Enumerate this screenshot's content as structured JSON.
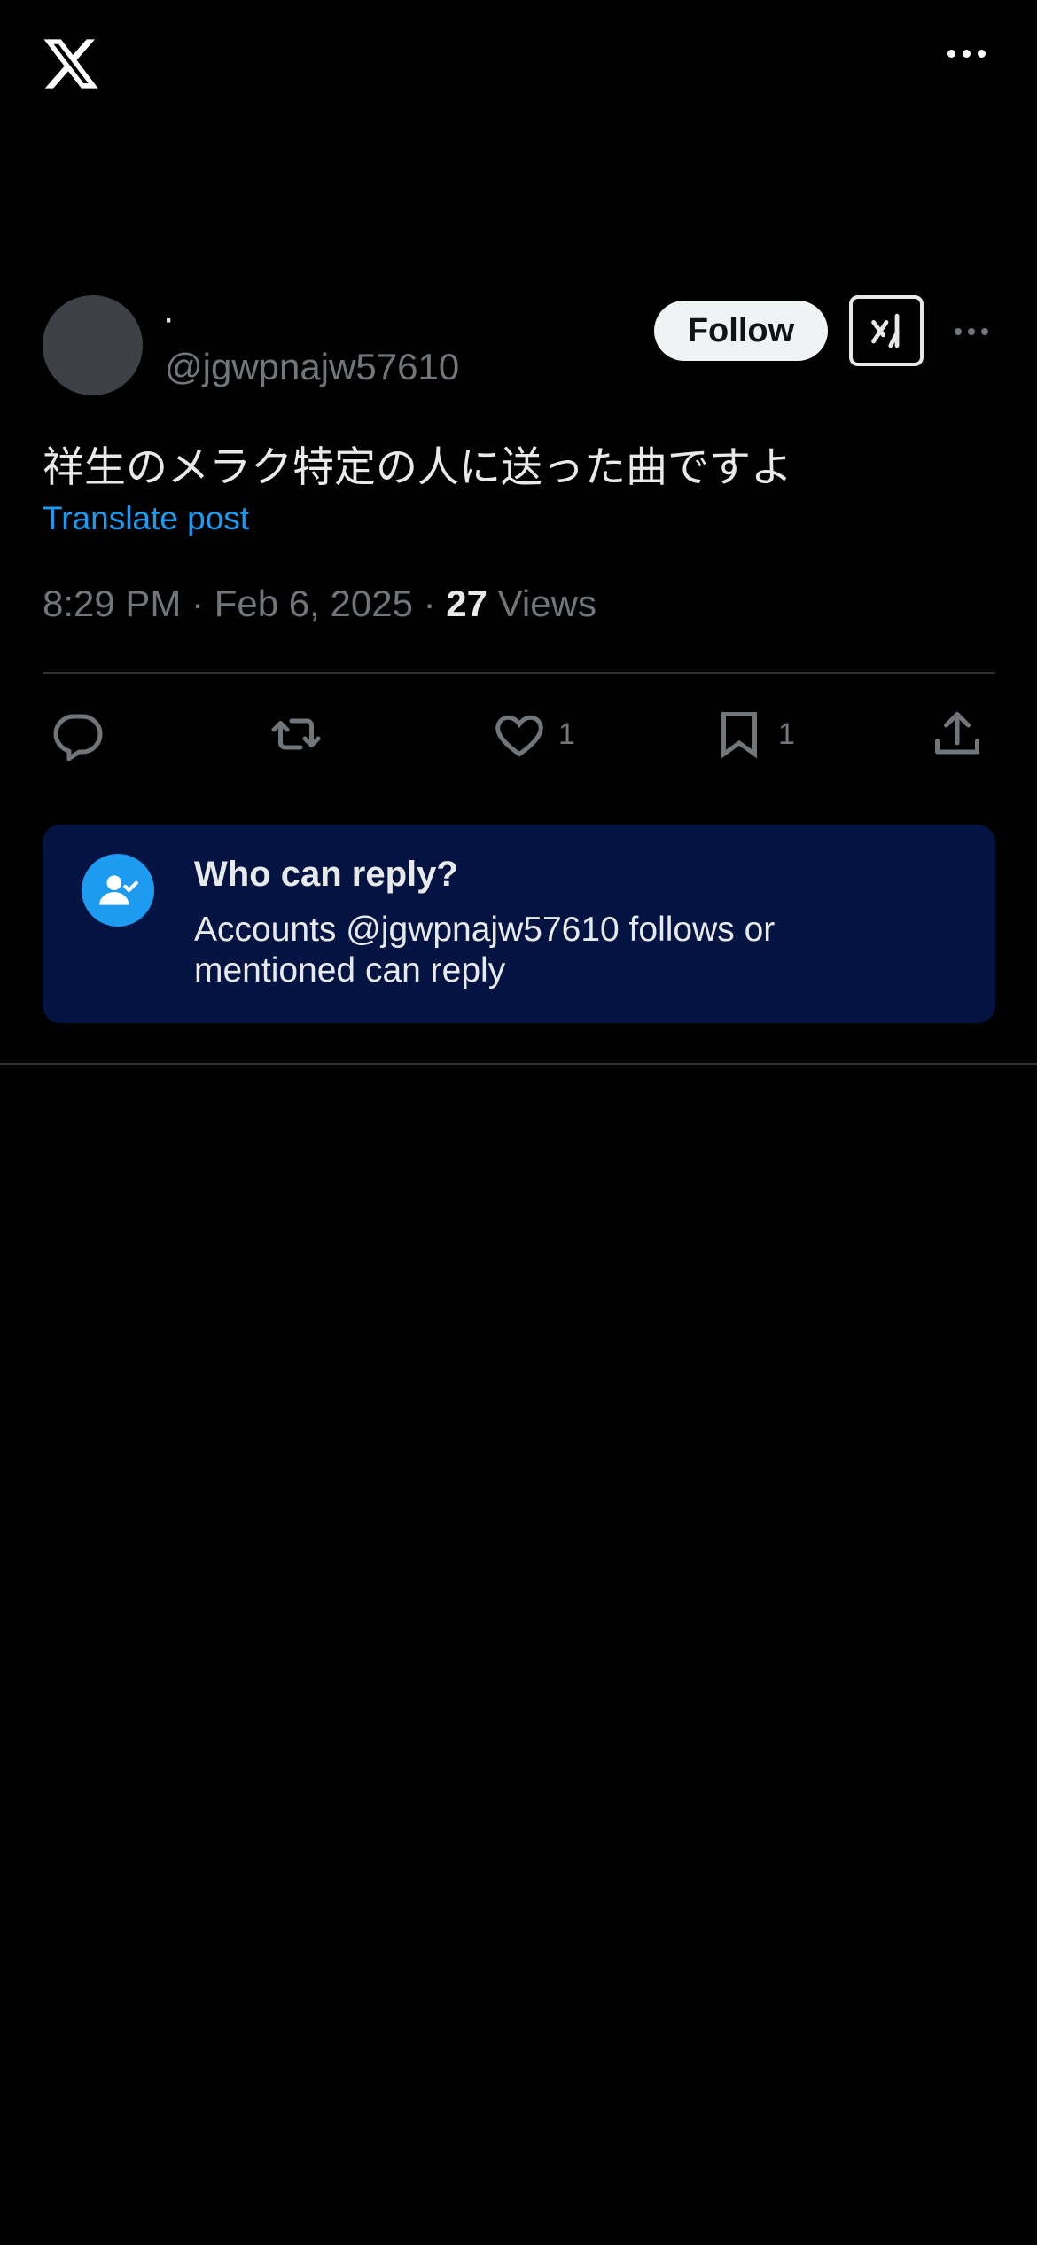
{
  "topbar": {
    "logo_icon": "x-logo-icon",
    "more_icon": "more-horizontal-icon"
  },
  "post": {
    "display_name": "·",
    "handle": "@jgwpnajw57610",
    "follow_label": "Follow",
    "grok_icon": "grok-icon",
    "text": "祥生のメラク特定の人に送った曲ですよ",
    "translate_label": "Translate post",
    "time": "8:29 PM",
    "date": "Feb 6, 2025",
    "separator": "·",
    "views_count": "27",
    "views_label": "Views"
  },
  "actions": {
    "reply": {
      "icon": "reply-icon",
      "count": ""
    },
    "repost": {
      "icon": "repost-icon",
      "count": ""
    },
    "like": {
      "icon": "heart-icon",
      "count": "1"
    },
    "bookmark": {
      "icon": "bookmark-icon",
      "count": "1"
    },
    "share": {
      "icon": "share-icon"
    }
  },
  "reply_restriction": {
    "title": "Who can reply?",
    "description": "Accounts @jgwpnajw57610 follows or mentioned can reply",
    "icon": "person-check-icon"
  },
  "colors": {
    "background": "#000000",
    "accent": "#1d9bf0",
    "muted": "#71767b",
    "card": "#031443"
  }
}
